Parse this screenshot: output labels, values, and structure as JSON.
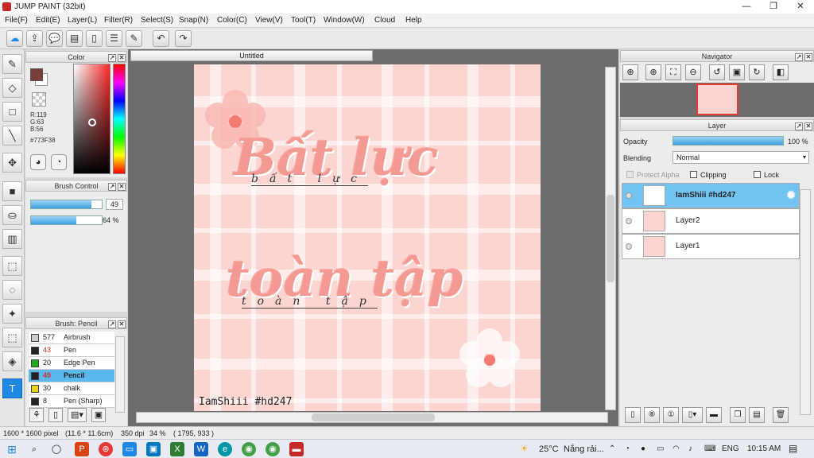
{
  "window": {
    "title": "JUMP PAINT (32bit)",
    "minimize": "—",
    "maximize": "❐",
    "close": "✕"
  },
  "menu": [
    "File(F)",
    "Edit(E)",
    "Layer(L)",
    "Filter(R)",
    "Select(S)",
    "Snap(N)",
    "Color(C)",
    "View(V)",
    "Tool(T)",
    "Window(W)",
    "Cloud",
    "Help"
  ],
  "toolbar": {
    "icons": [
      "cloud-icon",
      "export-icon",
      "comment-icon",
      "chat-icon",
      "page-icon",
      "list-icon",
      "edit-icon",
      "undo-icon",
      "redo-icon"
    ],
    "undo": "↶",
    "redo": "↷"
  },
  "colors": {
    "foreground": "#773F38",
    "accent": "#3aa2e0",
    "selected_row": "#73c3f2"
  },
  "color_panel": {
    "title": "Color",
    "r": "R:119",
    "g": "G:63",
    "b": "B:56",
    "hex": "#773F38"
  },
  "brush_control": {
    "title": "Brush Control",
    "size": "49",
    "opacity": "64 %",
    "size_fraction": 0.85,
    "opacity_fraction": 0.64
  },
  "brush_list": {
    "title": "Brush: Pencil",
    "items": [
      {
        "size": "577",
        "name": "Airbrush",
        "color": "#cccccc"
      },
      {
        "size": "43",
        "name": "Pen",
        "color": "#222222"
      },
      {
        "size": "20",
        "name": "Edge Pen",
        "color": "#22aa22"
      },
      {
        "size": "49",
        "name": "Pencil",
        "color": "#222222"
      },
      {
        "size": "30",
        "name": "chalk",
        "color": "#e8d020"
      },
      {
        "size": "8",
        "name": "Pen (Sharp)",
        "color": "#222222"
      }
    ]
  },
  "document": {
    "tab": "Untitled",
    "line1": "Bất lực",
    "line1_small": "bất lực",
    "line2": "toàn tập",
    "line2_small": "toàn tập",
    "signature": "IamShiii #hd247"
  },
  "navigator": {
    "title": "Navigator"
  },
  "layer_panel": {
    "title": "Layer",
    "opacity_label": "Opacity",
    "opacity_value": "100 %",
    "blending_label": "Blending",
    "blending_value": "Normal",
    "protect_alpha": "Protect Alpha",
    "clipping": "Clipping",
    "lock": "Lock",
    "layers": [
      {
        "name": "IamShiii #hd247",
        "selected": true
      },
      {
        "name": "Layer2",
        "selected": false
      },
      {
        "name": "Layer1",
        "selected": false
      }
    ]
  },
  "status": {
    "size": "1600 * 1600 pixel",
    "physical": "(11.6 * 11.6cm)",
    "dpi": "350 dpi",
    "zoom": "34 %",
    "coords": "( 1795, 933 )"
  },
  "taskbar": {
    "weather_temp": "25°C",
    "weather_text": "Nắng rải...",
    "language": "ENG",
    "time": "10:15 AM"
  }
}
